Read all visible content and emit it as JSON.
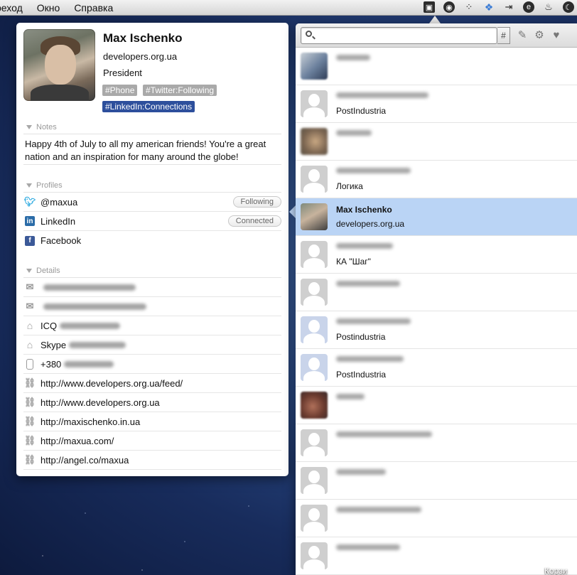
{
  "menubar": {
    "items": [
      "реход",
      "Окно",
      "Справка"
    ],
    "tray_icons": [
      "box-icon",
      "compass-icon",
      "grid-icon",
      "dropbox-icon",
      "arrow-in-icon",
      "e-icon",
      "flame-icon",
      "moon-icon"
    ]
  },
  "profile": {
    "name": "Max Ischenko",
    "site": "developers.org.ua",
    "title": "President",
    "tags": [
      "#Phone",
      "#Twitter:Following",
      "#LinkedIn:Connections"
    ],
    "notes_header": "Notes",
    "notes_text": "Happy 4th of July to all my american friends! You're a great nation and an inspiration for many around the globe!",
    "profiles_header": "Profiles",
    "profiles": [
      {
        "label": "@maxua",
        "badge": "Following",
        "icon": "twitter-icon"
      },
      {
        "label": "LinkedIn",
        "badge": "Connected",
        "icon": "linkedin-icon"
      },
      {
        "label": "Facebook",
        "badge": "",
        "icon": "facebook-icon"
      }
    ],
    "details_header": "Details",
    "details": {
      "icq_label": "ICQ",
      "skype_label": "Skype",
      "phone_prefix": "+380",
      "links": [
        "http://www.developers.org.ua/feed/",
        "http://www.developers.org.ua",
        "http://maxischenko.in.ua",
        "http://maxua.com/",
        "http://angel.co/maxua"
      ]
    }
  },
  "list": {
    "search_placeholder": "",
    "hash_label": "#",
    "contacts": [
      {
        "name": "",
        "sub": "",
        "avatar": "photo1",
        "selected": false
      },
      {
        "name": "",
        "sub": "PostIndustria",
        "avatar": "gray",
        "selected": false
      },
      {
        "name": "",
        "sub": "",
        "avatar": "photo2",
        "selected": false
      },
      {
        "name": "",
        "sub": "Логика",
        "avatar": "gray",
        "selected": false
      },
      {
        "name": "Max Ischenko",
        "sub": "developers.org.ua",
        "avatar": "photo3",
        "selected": true
      },
      {
        "name": "",
        "sub": "КА \"Шаг\"",
        "avatar": "gray",
        "selected": false
      },
      {
        "name": "",
        "sub": "",
        "avatar": "gray",
        "selected": false
      },
      {
        "name": "",
        "sub": "Postindustria",
        "avatar": "blue",
        "selected": false
      },
      {
        "name": "",
        "sub": "PostIndustria",
        "avatar": "blue",
        "selected": false
      },
      {
        "name": "",
        "sub": "",
        "avatar": "photo4",
        "selected": false
      },
      {
        "name": "",
        "sub": "",
        "avatar": "gray",
        "selected": false
      },
      {
        "name": "",
        "sub": "",
        "avatar": "gray",
        "selected": false
      },
      {
        "name": "",
        "sub": "",
        "avatar": "gray",
        "selected": false
      },
      {
        "name": "",
        "sub": "",
        "avatar": "gray",
        "selected": false
      }
    ]
  },
  "desktop": {
    "trash_label": "Корзи"
  },
  "colors": {
    "selection": "#bad4f5",
    "tag_gray": "#a9a9a9",
    "tag_blue": "#2d4f9c"
  }
}
